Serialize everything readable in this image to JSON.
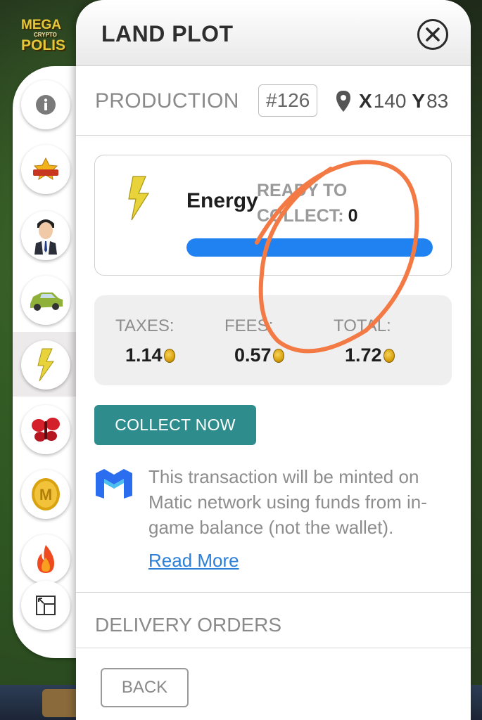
{
  "game": {
    "logo_line1": "MEGA",
    "logo_line2": "CRYPTO",
    "logo_line3": "POLIS"
  },
  "rail": {
    "items": [
      {
        "name": "info-icon"
      },
      {
        "name": "influence-badge-icon"
      },
      {
        "name": "businessman-avatar-icon"
      },
      {
        "name": "car-icon"
      },
      {
        "name": "energy-bolt-icon",
        "active": true
      },
      {
        "name": "butterfly-icon"
      },
      {
        "name": "coin-icon"
      },
      {
        "name": "fire-icon"
      },
      {
        "name": "expand-icon"
      }
    ]
  },
  "panel": {
    "title": "LAND PLOT",
    "close_icon": "close-icon"
  },
  "production": {
    "label": "PRODUCTION",
    "plot_id": "#126",
    "x_label": "X",
    "x_value": "140",
    "y_label": "Y",
    "y_value": "83"
  },
  "resource": {
    "name": "Energy",
    "ready_label_line1": "READY TO",
    "ready_label_line2": "COLLECT:",
    "ready_count": "0",
    "progress_fraction": 1.0
  },
  "fees": {
    "taxes_label": "TAXES:",
    "taxes_value": "1.14",
    "fees_label": "FEES:",
    "fees_value": "0.57",
    "total_label": "TOTAL:",
    "total_value": "1.72"
  },
  "actions": {
    "collect_label": "COLLECT NOW",
    "back_label": "BACK"
  },
  "info": {
    "text": "This transaction will be minted on Matic network using funds from in-game balance (not the wallet).",
    "read_more": "Read More"
  },
  "delivery": {
    "label": "DELIVERY ORDERS"
  },
  "colors": {
    "accent_teal": "#2e8c8c",
    "progress_blue": "#1f82f0",
    "annotation_orange": "#f47a45"
  }
}
